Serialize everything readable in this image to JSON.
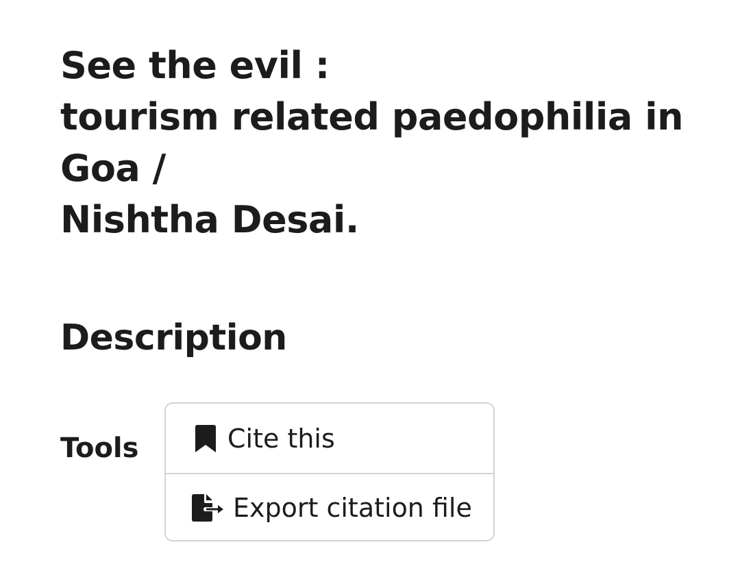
{
  "record": {
    "title_lines": [
      "See the evil :",
      "tourism related paedophilia in",
      "Goa /",
      "Nishtha Desai."
    ]
  },
  "description": {
    "heading": "Description"
  },
  "tools": {
    "label": "Tools",
    "items": [
      {
        "label": "Cite this",
        "icon": "bookmark-icon"
      },
      {
        "label": "Export citation file",
        "icon": "file-export-icon"
      }
    ]
  },
  "colors": {
    "text": "#1c1c1c",
    "border": "#d4d4d4",
    "background": "#ffffff"
  }
}
